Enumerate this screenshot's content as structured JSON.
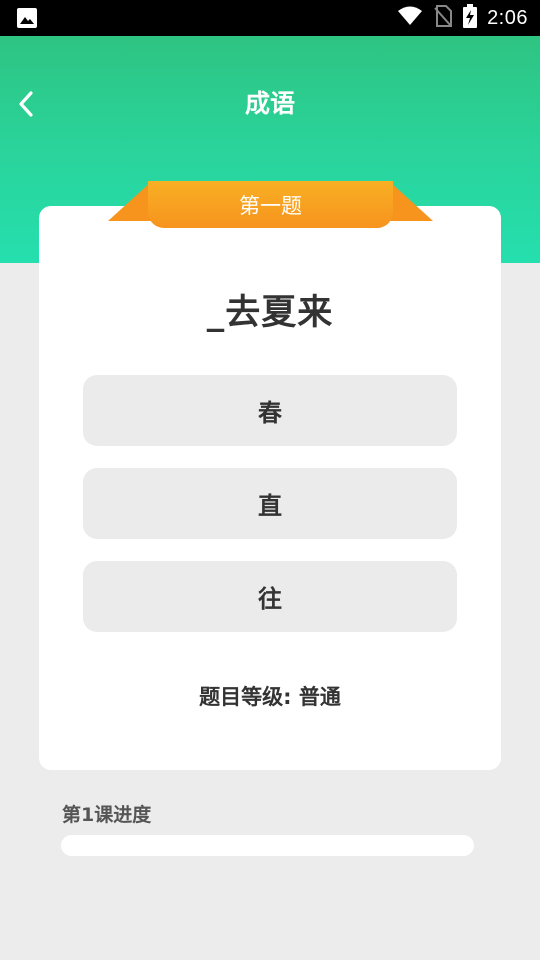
{
  "status_bar": {
    "time": "2:06",
    "icons": [
      "image-icon",
      "wifi-icon",
      "no-sim-icon",
      "battery-charging-icon"
    ]
  },
  "app_bar": {
    "title": "成语",
    "back_icon": "chevron-left-icon"
  },
  "quiz": {
    "ribbon_label": "第一题",
    "question": "_去夏来",
    "options": [
      "春",
      "直",
      "往"
    ],
    "level_text": "题目等级: 普通"
  },
  "progress": {
    "label": "第1课进度",
    "value_fraction": 0
  },
  "colors": {
    "header_top": "#2fbf7a",
    "header_bottom": "#25dfae",
    "ribbon": "#f7941d",
    "background": "#ececec",
    "option_bg": "#ebebeb"
  }
}
